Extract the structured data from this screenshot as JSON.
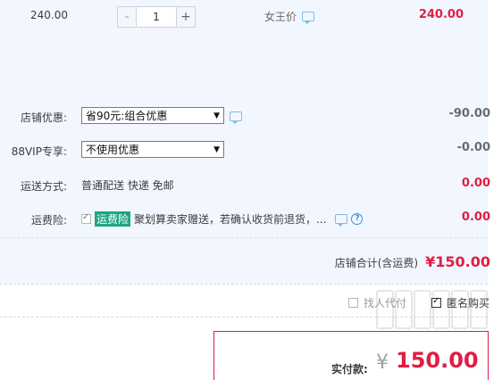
{
  "item": {
    "unit_price": "240.00",
    "quantity": "1",
    "minus": "-",
    "plus": "+",
    "seller_name": "女王价",
    "subtotal": "240.00"
  },
  "rows": {
    "store_discount": {
      "label": "店铺优惠:",
      "selected": "省90元:组合优惠",
      "amount": "-90.00"
    },
    "vip": {
      "label": "88VIP专享:",
      "selected": "不使用优惠",
      "amount": "-0.00"
    },
    "shipping": {
      "label": "运送方式:",
      "text": "普通配送 快递 免邮",
      "amount": "0.00"
    },
    "insurance": {
      "label": "运费险:",
      "tag": "运费险",
      "text": "聚划算卖家赠送，若确认收货前退货，...",
      "amount": "0.00"
    }
  },
  "store_total": {
    "label": "店铺合计(含运费)",
    "amount": "¥150.00"
  },
  "options": {
    "proxy_pay": "找人代付",
    "anonymous": "匿名购买"
  },
  "payment": {
    "label": "实付款:",
    "currency": "¥",
    "amount": "150.00"
  },
  "icons": [
    "chat-icon",
    "help-icon",
    "chevron-down-icon",
    "checkbox-icon"
  ],
  "colors": {
    "accent": "#e01e44",
    "panel_bg": "#f2f7ff",
    "tag_green": "#1ba784"
  }
}
